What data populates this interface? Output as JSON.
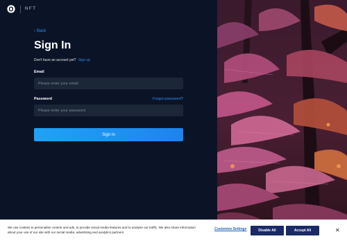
{
  "brand": {
    "name": "NFT",
    "icon": "crypto-logo-icon"
  },
  "nav": {
    "back_label": "Back"
  },
  "form": {
    "title": "Sign In",
    "signup_prompt": "Don't have an account yet?",
    "signup_link": "Sign up",
    "email_label": "Email",
    "email_placeholder": "Please enter your email",
    "password_label": "Password",
    "forgot_link": "Forgot password?",
    "password_placeholder": "Please enter your password",
    "submit_label": "Sign In"
  },
  "cookie_banner": {
    "text": "We use cookies to personalise content and ads, to provide social media features and to analyse our traffic. We also share information about your use of our site with our social media, advertising and analytics partners.",
    "customize_label": "Customize Settings",
    "disable_label": "Disable All",
    "accept_label": "Accept All",
    "close_icon": "close-icon"
  },
  "colors": {
    "background": "#0b1426",
    "accent": "#2f8cf2",
    "button_dark": "#1a2a66"
  }
}
